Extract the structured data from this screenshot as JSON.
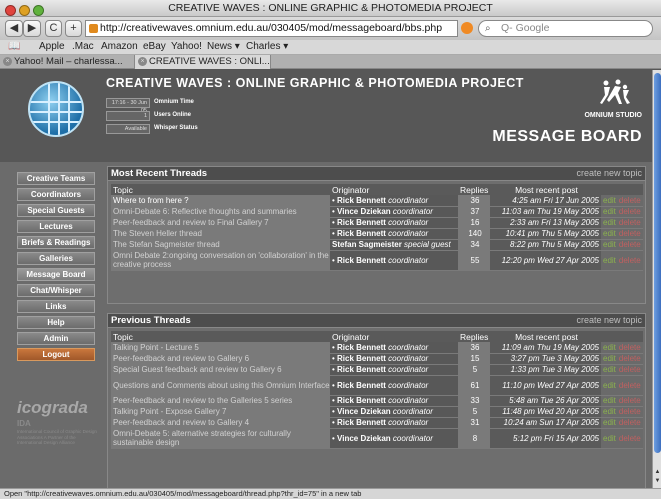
{
  "window": {
    "title": "CREATIVE WAVES : ONLINE GRAPHIC & PHOTOMEDIA PROJECT"
  },
  "toolbar": {
    "back_label": "◀",
    "forward_label": "▶",
    "reload_label": "C",
    "add_label": "+",
    "url": "http://creativewaves.omnium.edu.au/030405/mod/messageboard/bbs.php",
    "search_placeholder": "Q- Google"
  },
  "bookmarks": [
    "Apple",
    ".Mac",
    "Amazon",
    "eBay",
    "Yahoo!",
    "News ▾",
    "Charles ▾"
  ],
  "tabs": [
    {
      "label": "Yahoo! Mail – charlessa..."
    },
    {
      "label": "CREATIVE WAVES : ONLI..."
    }
  ],
  "header": {
    "site_title": "CREATIVE WAVES : ONLINE GRAPHIC & PHOTOMEDIA PROJECT",
    "status_time": "17:16 - 30 Jun 05",
    "status_time_label": "Omnium Time",
    "users_online_value": "1",
    "users_online_label": "Users Online",
    "whisper_value": "Available",
    "whisper_label": "Whisper Status",
    "studio_name": "OMNIUM STUDIO",
    "board_title": "MESSAGE BOARD"
  },
  "nav": [
    "Creative Teams",
    "Coordinators",
    "Special Guests",
    "Lectures",
    "Briefs & Readings",
    "Galleries",
    "Message Board",
    "Chat/Whisper",
    "Links",
    "Help",
    "Admin",
    "Logout"
  ],
  "sponsor": {
    "name": "icograda",
    "sub": "IDA",
    "text": "International Council of Graphic Design Associations A Partner of the International Design Alliance"
  },
  "columns": {
    "topic": "Topic",
    "originator": "Originator",
    "replies": "Replies",
    "recent": "Most recent post"
  },
  "actions": {
    "edit": "edit",
    "delete": "delete"
  },
  "recent": {
    "title": "Most Recent Threads",
    "link": "create new topic",
    "rows": [
      {
        "topic": "Where to from here ?",
        "name": "Rick Bennett",
        "role": "coordinator",
        "replies": "36",
        "when": "4:25 am Fri 17 Jun 2005"
      },
      {
        "topic": "Omni-Debate 6: Reflective thoughts and summaries",
        "name": "Vince Dziekan",
        "role": "coordinator",
        "replies": "37",
        "when": "11:03 am Thu 19 May 2005"
      },
      {
        "topic": "Peer-feedback and review to Final Gallery 7",
        "name": "Rick Bennett",
        "role": "coordinator",
        "replies": "16",
        "when": "2:33 am Fri 13 May 2005"
      },
      {
        "topic": "The Steven Heller thread",
        "name": "Rick Bennett",
        "role": "coordinator",
        "replies": "140",
        "when": "10:41 pm Thu 5 May 2005"
      },
      {
        "topic": "The Stefan Sagmeister thread",
        "name": "Stefan Sagmeister",
        "role": "special guest",
        "replies": "34",
        "when": "8:22 pm Thu 5 May 2005"
      },
      {
        "topic": "Omni Debate 2:ongoing conversation on 'collaboration' in the creative process",
        "name": "Rick Bennett",
        "role": "coordinator",
        "replies": "55",
        "when": "12:20 pm Wed 27 Apr 2005"
      }
    ]
  },
  "previous": {
    "title": "Previous Threads",
    "link": "create new topic",
    "rows": [
      {
        "topic": "Talking Point - Lecture 5",
        "name": "Rick Bennett",
        "role": "coordinator",
        "replies": "36",
        "when": "11:09 am Thu 19 May 2005"
      },
      {
        "topic": "Peer-feedback and review to Gallery 6",
        "name": "Rick Bennett",
        "role": "coordinator",
        "replies": "15",
        "when": "3:27 pm Tue 3 May 2005"
      },
      {
        "topic": "Special Guest feedback and review to Gallery 6",
        "name": "Rick Bennett",
        "role": "coordinator",
        "replies": "5",
        "when": "1:33 pm Tue 3 May 2005"
      },
      {
        "topic": "Questions and Comments about using this Omnium Interface",
        "name": "Rick Bennett",
        "role": "coordinator",
        "replies": "61",
        "when": "11:10 pm Wed 27 Apr 2005"
      },
      {
        "topic": "Peer-feedback and review to the Galleries 5 series",
        "name": "Rick Bennett",
        "role": "coordinator",
        "replies": "33",
        "when": "5:48 am Tue 26 Apr 2005"
      },
      {
        "topic": "Talking Point - Expose Gallery 7",
        "name": "Vince Dziekan",
        "role": "coordinator",
        "replies": "5",
        "when": "11:48 pm Wed 20 Apr 2005"
      },
      {
        "topic": "Peer-feedback and review to Gallery 4",
        "name": "Rick Bennett",
        "role": "coordinator",
        "replies": "31",
        "when": "10:24 am Sun 17 Apr 2005"
      },
      {
        "topic": "Omni-Debate 5: alternative strategies for culturally sustainable design",
        "name": "Vince Dziekan",
        "role": "coordinator",
        "replies": "8",
        "when": "5:12 pm Fri 15 Apr 2005"
      }
    ]
  },
  "statusbar": "Open \"http://creativewaves.omnium.edu.au/030405/mod/messageboard/thread.php?thr_id=75\" in a new tab",
  "colors": {
    "edit": "#8bb24d",
    "delete": "#c06060",
    "logout": "#c9773d",
    "panel_bg": "#6e6e6e"
  }
}
